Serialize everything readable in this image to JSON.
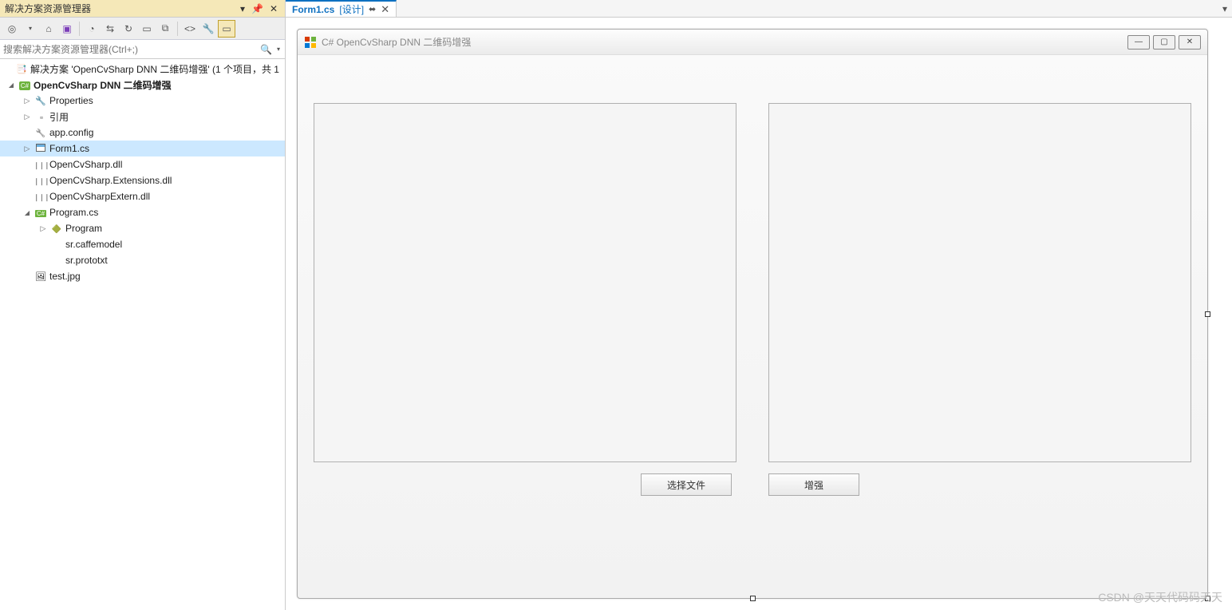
{
  "panel": {
    "title": "解决方案资源管理器",
    "search_placeholder": "搜索解决方案资源管理器(Ctrl+;)"
  },
  "tree": {
    "solution": "解决方案 'OpenCvSharp DNN 二维码增强' (1 个项目，共 1",
    "project": "OpenCvSharp DNN 二维码增强",
    "properties": "Properties",
    "references": "引用",
    "appconfig": "app.config",
    "form1cs": "Form1.cs",
    "dll1": "OpenCvSharp.dll",
    "dll2": "OpenCvSharp.Extensions.dll",
    "dll3": "OpenCvSharpExtern.dll",
    "programcs": "Program.cs",
    "program": "Program",
    "caffemodel": "sr.caffemodel",
    "prototxt": "sr.prototxt",
    "testimg": "test.jpg"
  },
  "tab": {
    "name": "Form1.cs",
    "suffix": "[设计]"
  },
  "form": {
    "title": "C# OpenCvSharp DNN 二维码增强",
    "btn_select": "选择文件",
    "btn_enhance": "增强"
  },
  "watermark": "CSDN @天天代码码天天",
  "icons": {
    "cs": "C#"
  }
}
